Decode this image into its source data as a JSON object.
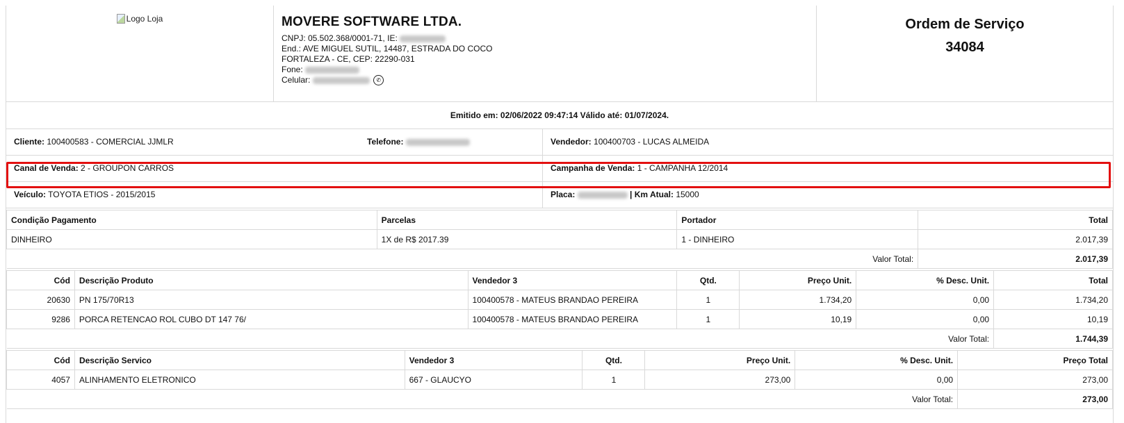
{
  "header": {
    "logo_alt": "Logo Loja",
    "company_name": "MOVERE SOFTWARE LTDA.",
    "cnpj_label": "CNPJ: 05.502.368/0001-71, IE:",
    "address_line": "End.: AVE MIGUEL SUTIL, 14487, ESTRADA DO COCO",
    "city_line": "FORTALEZA - CE, CEP: 22290-031",
    "phone_label": "Fone:",
    "mobile_label": "Celular:",
    "doc_title": "Ordem de Serviço",
    "doc_number": "34084"
  },
  "emitted": "Emitido em: 02/06/2022 09:47:14 Válido até: 01/07/2024.",
  "info": {
    "client_label": "Cliente:",
    "client_value": "100400583 - COMERCIAL JJMLR",
    "phone_label": "Telefone:",
    "seller_label": "Vendedor:",
    "seller_value": "100400703 - LUCAS ALMEIDA",
    "channel_label": "Canal de Venda:",
    "channel_value": "2 - GROUPON CARROS",
    "campaign_label": "Campanha de Venda:",
    "campaign_value": "1 - CAMPANHA 12/2014",
    "vehicle_label": "Veículo:",
    "vehicle_value": "TOYOTA ETIOS - 2015/2015",
    "plate_label": "Placa:",
    "km_label": "| Km Atual:",
    "km_value": "15000"
  },
  "payment": {
    "headers": [
      "Condição Pagamento",
      "Parcelas",
      "Portador",
      "Total"
    ],
    "row": [
      "DINHEIRO",
      "1X de R$ 2017.39",
      "1 - DINHEIRO",
      "2.017,39"
    ],
    "total_label": "Valor Total:",
    "total_value": "2.017,39"
  },
  "products": {
    "headers": [
      "Cód",
      "Descrição Produto",
      "Vendedor 3",
      "Qtd.",
      "Preço Unit.",
      "% Desc. Unit.",
      "Total"
    ],
    "rows": [
      [
        "20630",
        "PN 175/70R13",
        "100400578 - MATEUS BRANDAO PEREIRA",
        "1",
        "1.734,20",
        "0,00",
        "1.734,20"
      ],
      [
        "9286",
        "PORCA RETENCAO ROL CUBO DT 147 76/",
        "100400578 - MATEUS BRANDAO PEREIRA",
        "1",
        "10,19",
        "0,00",
        "10,19"
      ]
    ],
    "total_label": "Valor Total:",
    "total_value": "1.744,39"
  },
  "services": {
    "headers": [
      "Cód",
      "Descrição Servico",
      "Vendedor 3",
      "Qtd.",
      "Preço Unit.",
      "% Desc. Unit.",
      "Preço Total"
    ],
    "rows": [
      [
        "4057",
        "ALINHAMENTO ELETRONICO",
        "667 - GLAUCYO",
        "1",
        "273,00",
        "0,00",
        "273,00"
      ]
    ],
    "total_label": "Valor Total:",
    "total_value": "273,00"
  },
  "colors": {
    "highlight_border": "#e31010",
    "grid_line": "#d9d9d9"
  }
}
